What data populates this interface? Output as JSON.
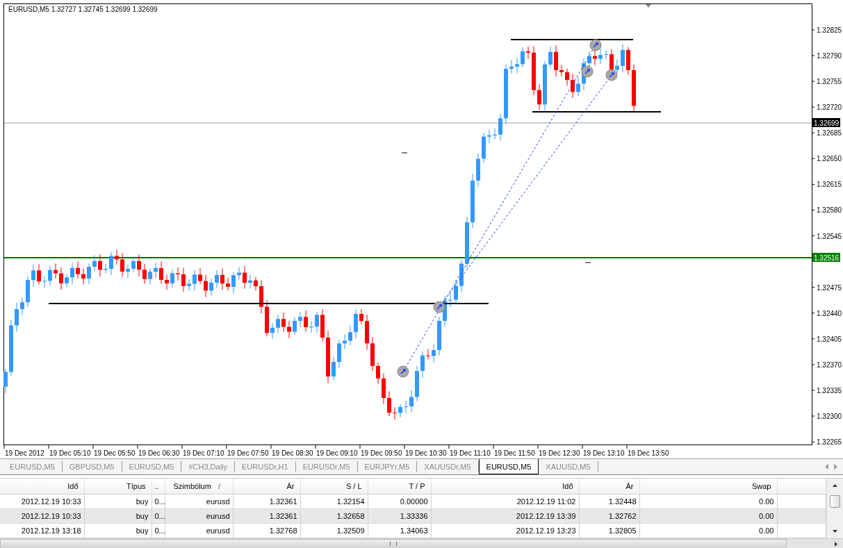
{
  "chart": {
    "header": "EURUSD,M5  1.32727 1.32745 1.32699 1.32699",
    "price_axis": [
      "1.32825",
      "1.32790",
      "1.32755",
      "1.32720",
      "1.32685",
      "1.32650",
      "1.32615",
      "1.32580",
      "1.32545",
      "1.32475",
      "1.32440",
      "1.32405",
      "1.32370",
      "1.32335",
      "1.32300",
      "1.32265"
    ],
    "price_markers": [
      {
        "label": "1.32699",
        "color": "#000000"
      },
      {
        "label": "1.32516",
        "color": "#008000"
      }
    ],
    "time_axis": [
      "19 Dec 2012",
      "19 Dec 05:10",
      "19 Dec 05:50",
      "19 Dec 06:30",
      "19 Dec 07:10",
      "19 Dec 07:50",
      "19 Dec 08:30",
      "19 Dec 09:10",
      "19 Dec 09:50",
      "19 Dec 10:30",
      "19 Dec 11:10",
      "19 Dec 11:50",
      "19 Dec 12:30",
      "19 Dec 13:10",
      "19 Dec 13:50"
    ]
  },
  "tabs": [
    {
      "label": "EURUSD,M5",
      "selected": false
    },
    {
      "label": "GBPUSD,M5",
      "selected": false
    },
    {
      "label": "EURUSD,M5",
      "selected": false
    },
    {
      "label": "#CH3,Daily",
      "selected": false
    },
    {
      "label": "EURUSDr,H1",
      "selected": false
    },
    {
      "label": "EURUSDr,M5",
      "selected": false
    },
    {
      "label": "EURJPYr,M5",
      "selected": false
    },
    {
      "label": "XAUUSDr,M5",
      "selected": false
    },
    {
      "label": "EURUSD,M5",
      "selected": true
    },
    {
      "label": "XAUUSD,M5",
      "selected": false
    }
  ],
  "table": {
    "columns": [
      {
        "label": "Idő"
      },
      {
        "label": "Típus"
      },
      {
        "label": ".."
      },
      {
        "label": "Szimbólum",
        "sort_indicator": "/"
      },
      {
        "label": "Ár"
      },
      {
        "label": "S / L"
      },
      {
        "label": "T / P"
      },
      {
        "label": "Idő"
      },
      {
        "label": "Ár"
      },
      {
        "label": "Swap"
      }
    ],
    "rows": [
      [
        "2012.12.19 10:33",
        "buy",
        "0...",
        "eurusd",
        "1.32361",
        "1.32154",
        "0.00000",
        "2012.12.19 11:02",
        "1.32448",
        "0.00"
      ],
      [
        "2012.12.19 10:33",
        "buy",
        "0...",
        "eurusd",
        "1.32361",
        "1.32658",
        "1.33336",
        "2012.12.19 13:39",
        "1.32762",
        "0.00"
      ],
      [
        "2012.12.19 13:18",
        "buy",
        "0...",
        "eurusd",
        "1.32768",
        "1.32509",
        "1.34063",
        "2012.12.19 13:23",
        "1.32805",
        "0.00"
      ]
    ]
  }
}
